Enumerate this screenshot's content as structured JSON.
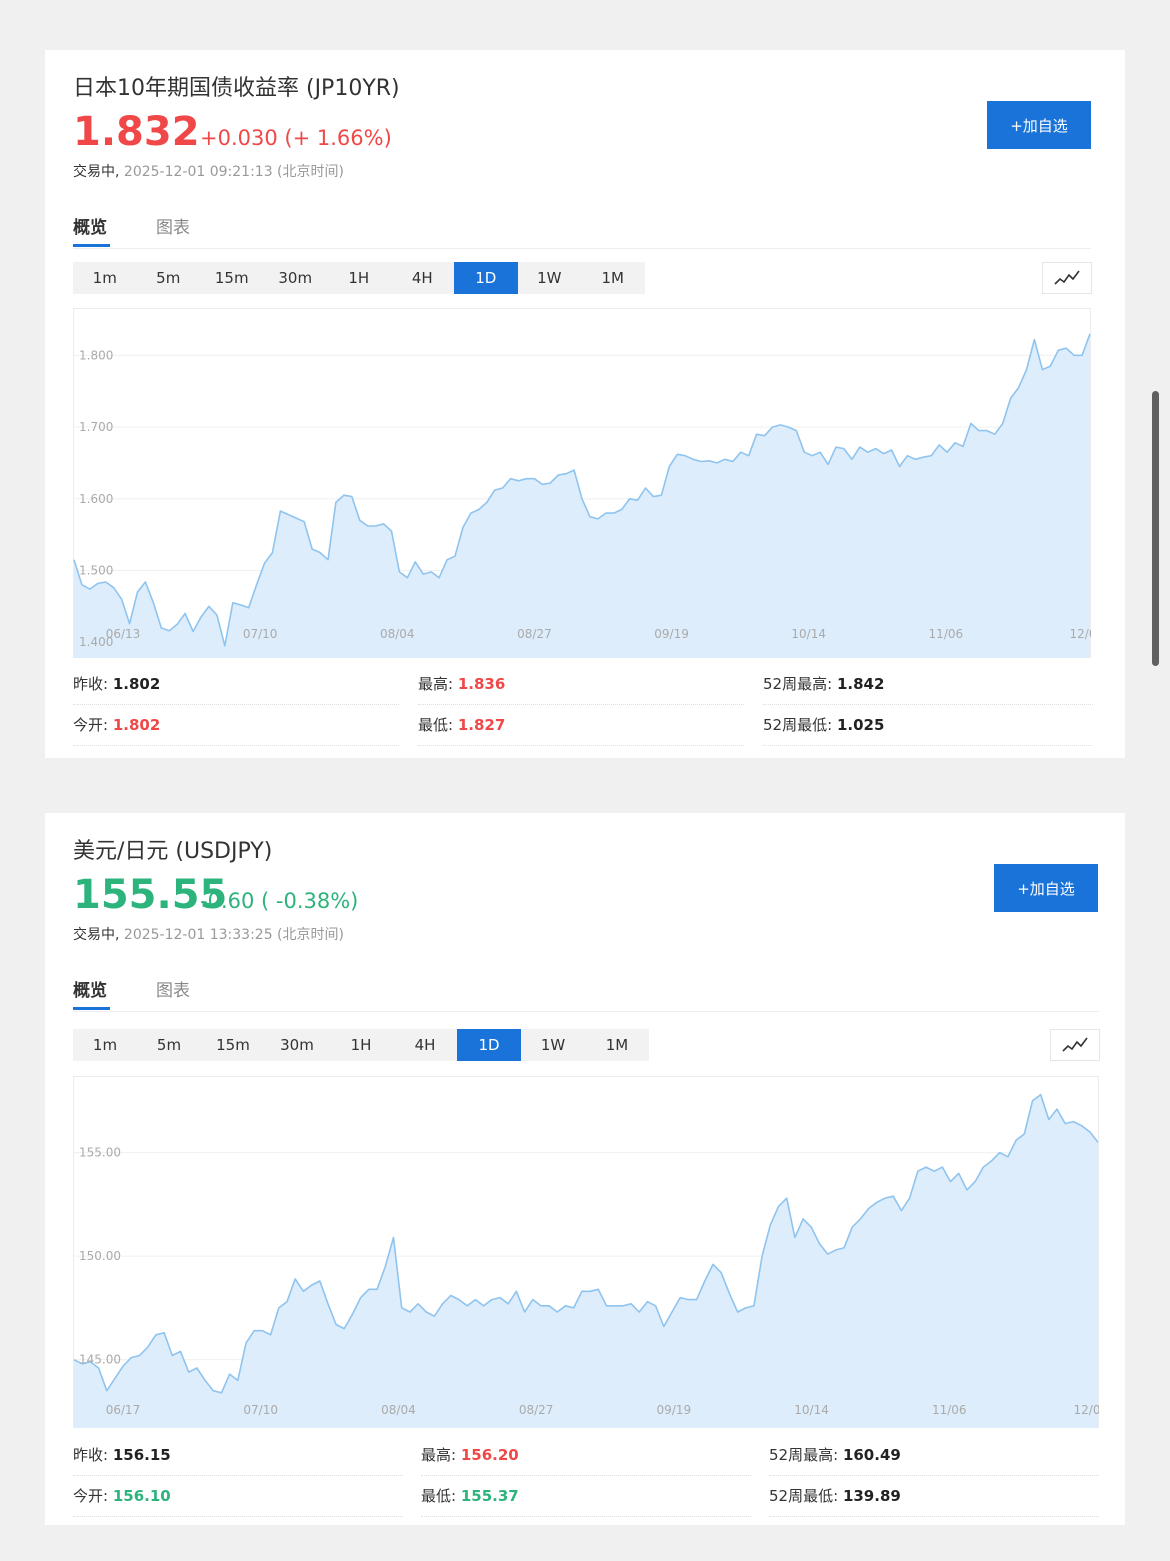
{
  "instruments": [
    {
      "title": "日本10年期国债收益率 (JP10YR)",
      "price": "1.832",
      "change": "+0.030 (+ 1.66%)",
      "direction": "up",
      "status_label": "交易中,",
      "timestamp": "2025-12-01 09:21:13 (北京时间)",
      "add_button": "+加自选",
      "tabs": [
        "概览",
        "图表"
      ],
      "periods": [
        "1m",
        "5m",
        "15m",
        "30m",
        "1H",
        "4H",
        "1D",
        "1W",
        "1M"
      ],
      "active_period": "1D",
      "stats": [
        [
          {
            "label": "昨收:",
            "value": "1.802",
            "tone": "neutral"
          },
          {
            "label": "最高:",
            "value": "1.836",
            "tone": "up"
          },
          {
            "label": "52周最高:",
            "value": "1.842",
            "tone": "neutral"
          }
        ],
        [
          {
            "label": "今开:",
            "value": "1.802",
            "tone": "up"
          },
          {
            "label": "最低:",
            "value": "1.827",
            "tone": "up"
          },
          {
            "label": "52周最低:",
            "value": "1.025",
            "tone": "neutral"
          }
        ]
      ]
    },
    {
      "title": "美元/日元 (USDJPY)",
      "price": "155.55",
      "change": "-0.60 ( -0.38%)",
      "direction": "down",
      "status_label": "交易中,",
      "timestamp": "2025-12-01 13:33:25 (北京时间)",
      "add_button": "+加自选",
      "tabs": [
        "概览",
        "图表"
      ],
      "periods": [
        "1m",
        "5m",
        "15m",
        "30m",
        "1H",
        "4H",
        "1D",
        "1W",
        "1M"
      ],
      "active_period": "1D",
      "stats": [
        [
          {
            "label": "昨收:",
            "value": "156.15",
            "tone": "neutral"
          },
          {
            "label": "最高:",
            "value": "156.20",
            "tone": "up"
          },
          {
            "label": "52周最高:",
            "value": "160.49",
            "tone": "neutral"
          }
        ],
        [
          {
            "label": "今开:",
            "value": "156.10",
            "tone": "down"
          },
          {
            "label": "最低:",
            "value": "155.37",
            "tone": "down"
          },
          {
            "label": "52周最低:",
            "value": "139.89",
            "tone": "neutral"
          }
        ]
      ]
    }
  ],
  "colors": {
    "up": "#f04848",
    "down": "#2db37c",
    "accent": "#1a73d9",
    "line": "#8fc4ee",
    "area": "#deedfc"
  },
  "chart_data": [
    {
      "type": "area",
      "x_ticks": [
        "06/13",
        "07/10",
        "08/04",
        "08/27",
        "09/19",
        "10/14",
        "11/06",
        "12/0"
      ],
      "y_ticks": [
        "1.800",
        "1.700",
        "1.600",
        "1.500",
        "1.400"
      ],
      "y_tick_values": [
        1.8,
        1.7,
        1.6,
        1.5,
        1.4
      ],
      "ylim": [
        1.378,
        1.866
      ],
      "grid": true,
      "values": [
        1.515,
        1.48,
        1.474,
        1.482,
        1.484,
        1.476,
        1.46,
        1.426,
        1.47,
        1.484,
        1.455,
        1.42,
        1.416,
        1.425,
        1.44,
        1.415,
        1.435,
        1.45,
        1.438,
        1.395,
        1.455,
        1.452,
        1.448,
        1.48,
        1.51,
        1.525,
        1.583,
        1.578,
        1.573,
        1.568,
        1.53,
        1.525,
        1.515,
        1.595,
        1.605,
        1.603,
        1.57,
        1.562,
        1.562,
        1.565,
        1.555,
        1.498,
        1.49,
        1.512,
        1.495,
        1.498,
        1.49,
        1.515,
        1.52,
        1.56,
        1.58,
        1.585,
        1.595,
        1.612,
        1.615,
        1.628,
        1.625,
        1.628,
        1.628,
        1.62,
        1.622,
        1.633,
        1.635,
        1.64,
        1.6,
        1.575,
        1.572,
        1.58,
        1.58,
        1.585,
        1.6,
        1.598,
        1.615,
        1.603,
        1.605,
        1.645,
        1.662,
        1.66,
        1.655,
        1.652,
        1.653,
        1.65,
        1.655,
        1.652,
        1.665,
        1.66,
        1.69,
        1.688,
        1.7,
        1.703,
        1.7,
        1.695,
        1.665,
        1.66,
        1.665,
        1.648,
        1.672,
        1.67,
        1.655,
        1.672,
        1.665,
        1.67,
        1.663,
        1.668,
        1.645,
        1.66,
        1.655,
        1.658,
        1.66,
        1.675,
        1.665,
        1.678,
        1.673,
        1.705,
        1.695,
        1.695,
        1.69,
        1.705,
        1.74,
        1.755,
        1.78,
        1.822,
        1.78,
        1.785,
        1.807,
        1.81,
        1.8,
        1.8,
        1.83
      ]
    },
    {
      "type": "area",
      "x_ticks": [
        "06/17",
        "07/10",
        "08/04",
        "08/27",
        "09/19",
        "10/14",
        "11/06",
        "12/0"
      ],
      "y_ticks": [
        "155.00",
        "150.00",
        "145.00"
      ],
      "y_tick_values": [
        155,
        150,
        145
      ],
      "ylim": [
        141.7,
        158.7
      ],
      "grid": true,
      "values": [
        145.0,
        144.8,
        144.9,
        144.6,
        143.5,
        144.1,
        144.7,
        145.1,
        145.2,
        145.6,
        146.2,
        146.3,
        145.2,
        145.4,
        144.4,
        144.6,
        144.0,
        143.5,
        143.4,
        144.3,
        144.0,
        145.8,
        146.4,
        146.4,
        146.2,
        147.5,
        147.8,
        148.9,
        148.3,
        148.6,
        148.8,
        147.7,
        146.7,
        146.5,
        147.2,
        148.0,
        148.4,
        148.4,
        149.5,
        150.9,
        147.5,
        147.3,
        147.7,
        147.3,
        147.1,
        147.7,
        148.1,
        147.9,
        147.6,
        147.9,
        147.6,
        147.9,
        148.0,
        147.7,
        148.3,
        147.3,
        147.9,
        147.6,
        147.6,
        147.3,
        147.6,
        147.5,
        148.3,
        148.3,
        148.4,
        147.6,
        147.6,
        147.6,
        147.7,
        147.3,
        147.8,
        147.6,
        146.6,
        147.3,
        148.0,
        147.9,
        147.9,
        148.8,
        149.6,
        149.2,
        148.2,
        147.3,
        147.5,
        147.6,
        150.0,
        151.5,
        152.4,
        152.8,
        150.9,
        151.8,
        151.4,
        150.6,
        150.1,
        150.3,
        150.4,
        151.4,
        151.8,
        152.3,
        152.6,
        152.8,
        152.9,
        152.2,
        152.8,
        154.1,
        154.3,
        154.1,
        154.3,
        153.6,
        154.0,
        153.2,
        153.6,
        154.3,
        154.6,
        155.0,
        154.8,
        155.6,
        155.9,
        157.5,
        157.8,
        156.6,
        157.1,
        156.4,
        156.5,
        156.3,
        156.0,
        155.5
      ]
    }
  ]
}
